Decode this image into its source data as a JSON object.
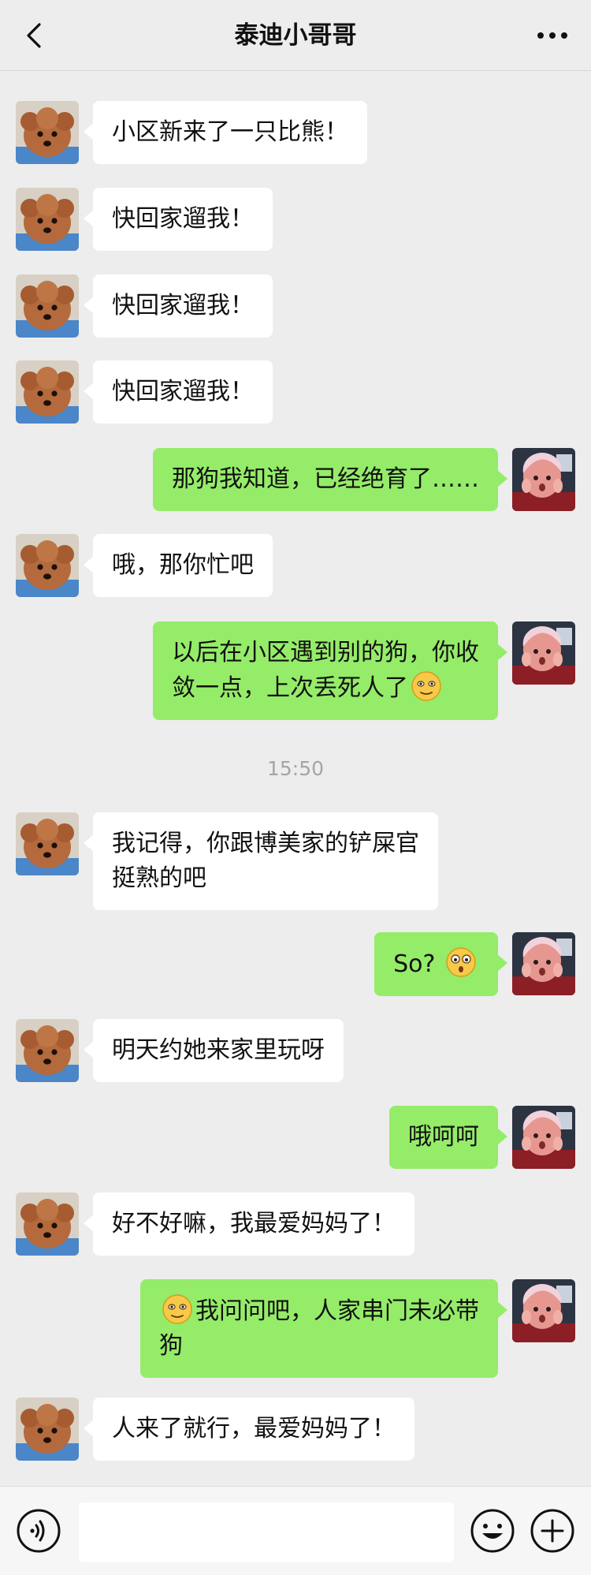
{
  "header": {
    "title": "泰迪小哥哥",
    "back_icon": "chevron-left-icon",
    "more_icon": "more-dots-icon"
  },
  "messages": [
    {
      "side": "in",
      "parts": [
        {
          "text": "小区新来了一只比熊！"
        }
      ]
    },
    {
      "side": "in",
      "parts": [
        {
          "text": "快回家遛我！"
        }
      ]
    },
    {
      "side": "in",
      "parts": [
        {
          "text": "快回家遛我！"
        }
      ]
    },
    {
      "side": "in",
      "parts": [
        {
          "text": "快回家遛我！"
        }
      ]
    },
    {
      "side": "out",
      "parts": [
        {
          "text": "那狗我知道，已经绝育了……"
        }
      ]
    },
    {
      "side": "in",
      "parts": [
        {
          "text": "哦，那你忙吧"
        }
      ]
    },
    {
      "side": "out",
      "parts": [
        {
          "text": "以后在小区遇到别的狗，你收"
        },
        {
          "br": true
        },
        {
          "text": "敛一点，上次丢死人了"
        },
        {
          "emoji": "awkward-smile-emoji"
        }
      ]
    },
    {
      "timestamp": "15:50"
    },
    {
      "side": "in",
      "parts": [
        {
          "text": "我记得，你跟博美家的铲屎官"
        },
        {
          "br": true
        },
        {
          "text": "挺熟的吧"
        }
      ]
    },
    {
      "side": "out",
      "parts": [
        {
          "text": "So? "
        },
        {
          "emoji": "surprised-face-emoji"
        }
      ]
    },
    {
      "side": "in",
      "parts": [
        {
          "text": "明天约她来家里玩呀"
        }
      ]
    },
    {
      "side": "out",
      "parts": [
        {
          "text": "哦呵呵"
        }
      ]
    },
    {
      "side": "in",
      "parts": [
        {
          "text": "好不好嘛，我最爱妈妈了！"
        }
      ]
    },
    {
      "side": "out",
      "parts": [
        {
          "emoji": "awkward-smile-emoji"
        },
        {
          "text": "我问问吧，人家串门未必带"
        },
        {
          "br": true
        },
        {
          "text": "狗"
        }
      ]
    },
    {
      "side": "in",
      "parts": [
        {
          "text": "人来了就行，最爱妈妈了！"
        }
      ]
    }
  ],
  "input_bar": {
    "voice_icon": "voice-icon",
    "emoji_icon": "emoji-icon",
    "plus_icon": "plus-icon"
  },
  "colors": {
    "background": "#ededed",
    "outgoing_bubble": "#95ec69",
    "incoming_bubble": "#ffffff"
  }
}
